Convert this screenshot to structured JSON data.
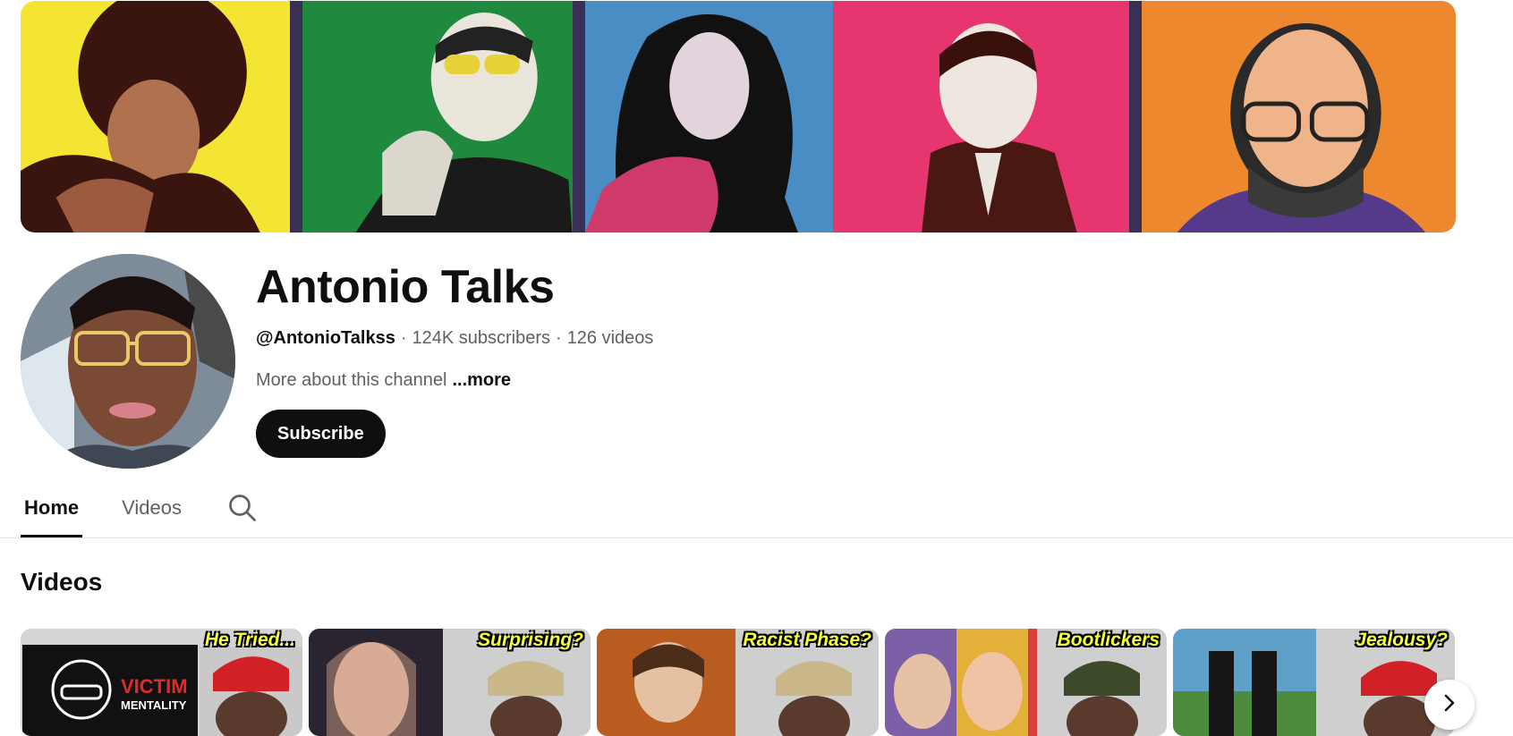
{
  "channel": {
    "name": "Antonio Talks",
    "handle": "@AntonioTalkss",
    "subscribers": "124K subscribers",
    "videos": "126 videos",
    "separator": "·",
    "about": "More about this channel",
    "more_label": "...more",
    "subscribe_label": "Subscribe"
  },
  "banner": {
    "panels": [
      {
        "bg": "#f4e533",
        "figure": "#3a1510"
      },
      {
        "bg": "#1f8a3e",
        "figure": "#1a1a1a"
      },
      {
        "bg": "#4a8cc4",
        "figure": "#111111"
      },
      {
        "bg": "#e7356f",
        "figure": "#4a1812"
      },
      {
        "bg": "#ee882f",
        "figure": "#1e1e1e"
      }
    ]
  },
  "tabs": [
    {
      "label": "Home",
      "active": true
    },
    {
      "label": "Videos",
      "active": false
    }
  ],
  "sections": {
    "videos_title": "Videos"
  },
  "videos": [
    {
      "caption": "He Tried...",
      "extra": "VICTIM",
      "extra_sub": "MENTALITY"
    },
    {
      "caption": "Surprising?"
    },
    {
      "caption": "Racist Phase?"
    },
    {
      "caption": "Bootlickers"
    },
    {
      "caption": "Jealousy?"
    }
  ],
  "colors": {
    "accent": "#0f0f0f",
    "secondary_text": "#606060",
    "caption_yellow": "#f6ff3a"
  }
}
